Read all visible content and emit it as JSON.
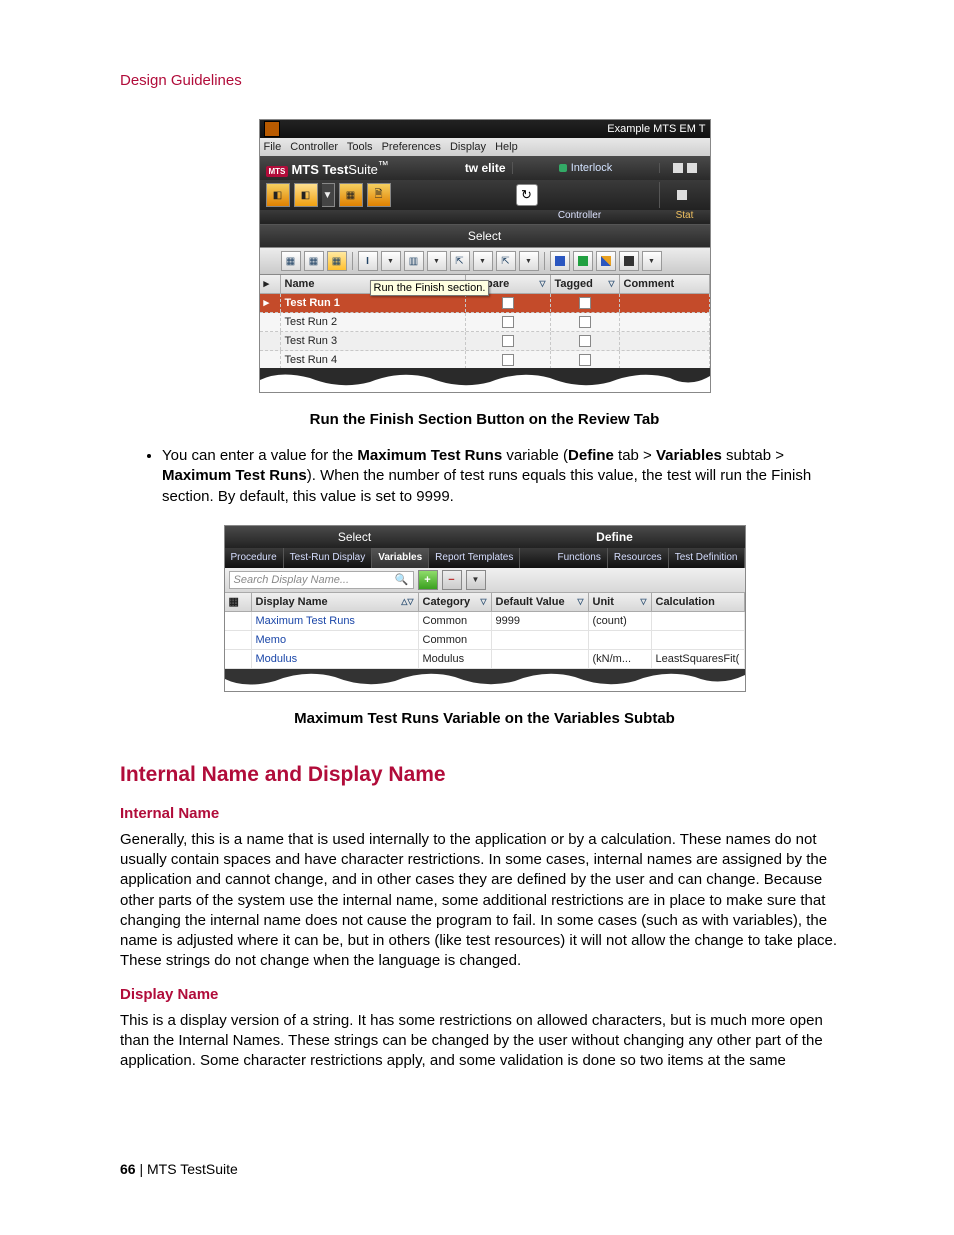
{
  "header": "Design Guidelines",
  "figure1": {
    "titlebar_right": "Example MTS EM T",
    "menubar": [
      "File",
      "Controller",
      "Tools",
      "Preferences",
      "Display",
      "Help"
    ],
    "brand_logo": "MTS",
    "brand_bold": "MTS Test",
    "brand_light": "Suite",
    "brand_sup": "™",
    "right_brand": "tw elite",
    "interlock": "Interlock",
    "controller_label": "Controller",
    "status_label": "Stat",
    "tab_select": "Select",
    "tooltip": "Run the Finish section.",
    "columns": {
      "name": "Name",
      "compare": "ompare",
      "tagged": "Tagged",
      "comment": "Comment"
    },
    "rows": [
      {
        "name": "Test Run 1",
        "selected": true
      },
      {
        "name": "Test Run 2",
        "selected": false
      },
      {
        "name": "Test Run 3",
        "selected": false
      },
      {
        "name": "Test Run 4",
        "selected": false
      }
    ],
    "caption": "Run the Finish Section Button on the Review Tab"
  },
  "bullet": {
    "pre": "You can enter a value for the ",
    "b1": "Maximum Test Runs",
    "mid1": " variable (",
    "b2": "Define",
    "mid2": " tab > ",
    "b3": "Variables",
    "mid3": " subtab > ",
    "b4": "Maximum Test Runs",
    "post": "). When the number of test runs equals this value, the test will run the Finish section. By default, this value is set to 9999."
  },
  "figure2": {
    "top_tabs": {
      "left": "Select",
      "right": "Define"
    },
    "subtabs": [
      "Procedure",
      "Test-Run Display",
      "Variables",
      "Report Templates",
      "Functions",
      "Resources",
      "Test Definition"
    ],
    "subtab_selected": "Variables",
    "search_placeholder": "Search Display Name...",
    "columns": {
      "display_name": "Display Name",
      "category": "Category",
      "default_value": "Default Value",
      "unit": "Unit",
      "calculation": "Calculation"
    },
    "rows": [
      {
        "dn": "Maximum Test Runs",
        "cat": "Common",
        "dv": "9999",
        "unit": "(count)",
        "calc": ""
      },
      {
        "dn": "Memo",
        "cat": "Common",
        "dv": "",
        "unit": "",
        "calc": ""
      },
      {
        "dn": "Modulus",
        "cat": "Modulus",
        "dv": "",
        "unit": "(kN/m...",
        "calc": "LeastSquaresFit("
      }
    ],
    "caption": "Maximum Test Runs Variable on the Variables Subtab"
  },
  "section_h2": "Internal Name and Display Name",
  "internal_name_h": "Internal Name",
  "internal_name_p": "Generally, this is a name that is used internally to the application or by a calculation. These names do not usually contain spaces and have character restrictions. In some cases, internal names are assigned by the application and cannot change, and in other cases they are defined by the user and can change. Because other parts of the system use the internal name, some additional restrictions are in place to make sure that changing the internal name does not cause the program to fail. In some cases (such as with variables), the name is adjusted where it can be, but in others (like test resources) it will not allow the change to take place. These strings do not change when the language is changed.",
  "display_name_h": "Display Name",
  "display_name_p": "This is a display version of a string. It has some restrictions on allowed characters, but is much more open than the Internal Names. These strings can be changed by the user without changing any other part of the application. Some character restrictions apply, and some validation is done so two items at the same",
  "footer_page": "66",
  "footer_sep": " | ",
  "footer_product": "MTS TestSuite"
}
